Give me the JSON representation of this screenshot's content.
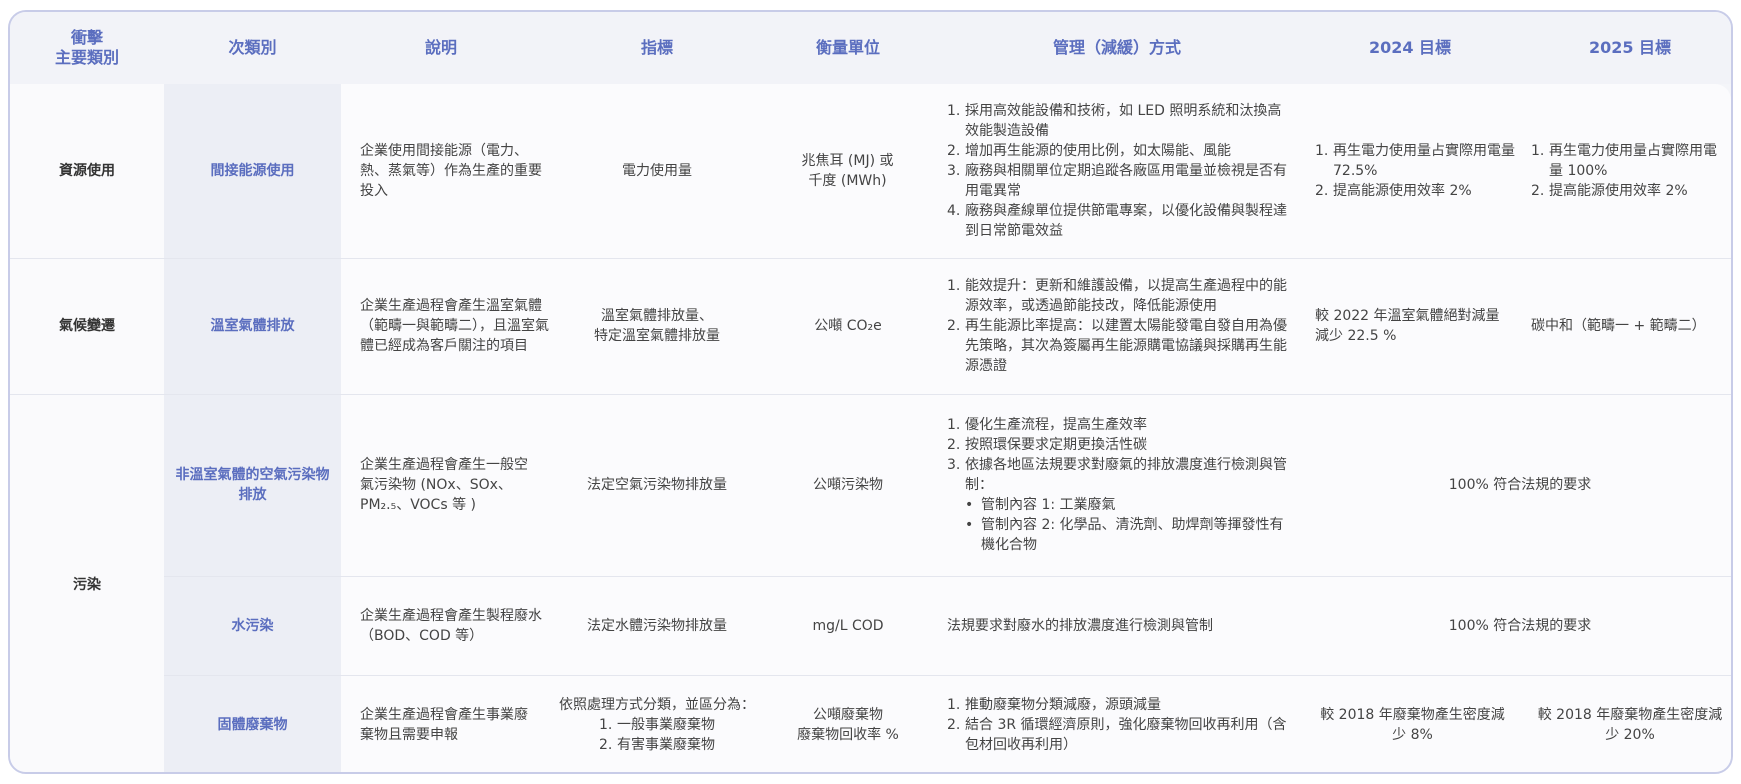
{
  "headers": {
    "cat_line1": "衝擊",
    "cat_line2": "主要類別",
    "sub": "次類別",
    "desc": "說明",
    "indicator": "指標",
    "unit": "衡量單位",
    "method": "管理（減緩）方式",
    "t2024": "2024 目標",
    "t2025": "2025 目標"
  },
  "rows": [
    {
      "category": "資源使用",
      "sub": "間接能源使用",
      "desc": "企業使用間接能源（電力、熱、蒸氣等）作為生產的重要投入",
      "indicator": "電力使用量",
      "unit": "兆焦耳 (MJ) 或千度 (MWh)",
      "methods": [
        "採用高效能設備和技術，如 LED 照明系統和汰換高效能製造設備",
        "增加再生能源的使用比例，如太陽能、風能",
        "廠務與相關單位定期追蹤各廠區用電量並檢視是否有用電異常",
        "廠務與產線單位提供節電專案，以優化設備與製程達到日常節電效益"
      ],
      "t2024": [
        "再生電力使用量占實際用電量 72.5%",
        "提高能源使用效率 2%"
      ],
      "t2025": [
        "再生電力使用量占實際用電量 100%",
        "提高能源使用效率 2%"
      ]
    },
    {
      "category": "氣候變遷",
      "sub": "溫室氣體排放",
      "desc": "企業生產過程會產生溫室氣體（範疇一與範疇二），且溫室氣體已經成為客戶關注的項目",
      "indicator_l1": "溫室氣體排放量、",
      "indicator_l2": "特定溫室氣體排放量",
      "unit": "公噸 CO₂e",
      "methods": [
        "能效提升：更新和維護設備，以提高生產過程中的能源效率，或透過節能技改，降低能源使用",
        "再生能源比率提高：以建置太陽能發電自發自用為優先策略，其次為簽屬再生能源購電協議與採購再生能源憑證"
      ],
      "t2024": "較 2022 年溫室氣體絕對減量減少 22.5 %",
      "t2025": "碳中和（範疇一 + 範疇二）"
    },
    {
      "category": "污染",
      "sub": "非溫室氣體的空氣污染物排放",
      "desc": "企業生產過程會產生一般空氣污染物 (NOx、SOx、PM₂.₅、VOCs 等 )",
      "indicator": "法定空氣污染物排放量",
      "unit": "公噸污染物",
      "methods": [
        "優化生產流程，提高生產效率",
        "按照環保要求定期更換活性碳",
        "依據各地區法規要求對廢氣的排放濃度進行檢測與管制："
      ],
      "bullets": [
        "管制內容 1: 工業廢氣",
        "管制內容 2: 化學品、清洗劑、助焊劑等揮發性有機化合物"
      ],
      "target": "100% 符合法規的要求"
    },
    {
      "sub": "水污染",
      "desc": "企業生產過程會產生製程廢水（BOD、COD 等）",
      "indicator": "法定水體污染物排放量",
      "unit": "mg/L COD",
      "method": "法規要求對廢水的排放濃度進行檢測與管制",
      "target": "100% 符合法規的要求"
    },
    {
      "sub": "固體廢棄物",
      "desc": "企業生產過程會產生事業廢棄物且需要申報",
      "indicator_intro": "依照處理方式分類，並區分為：",
      "indicator_items": [
        "一般事業廢棄物",
        "有害事業廢棄物"
      ],
      "unit_l1": "公噸廢棄物",
      "unit_l2": "廢棄物回收率 %",
      "methods": [
        "推動廢棄物分類減廢，源頭減量",
        "結合 3R 循環經濟原則，強化廢棄物回收再利用（含包材回收再利用）"
      ],
      "t2024": "較 2018 年廢棄物產生密度減少 8%",
      "t2025": "較 2018 年廢棄物產生密度減少 20%"
    }
  ]
}
